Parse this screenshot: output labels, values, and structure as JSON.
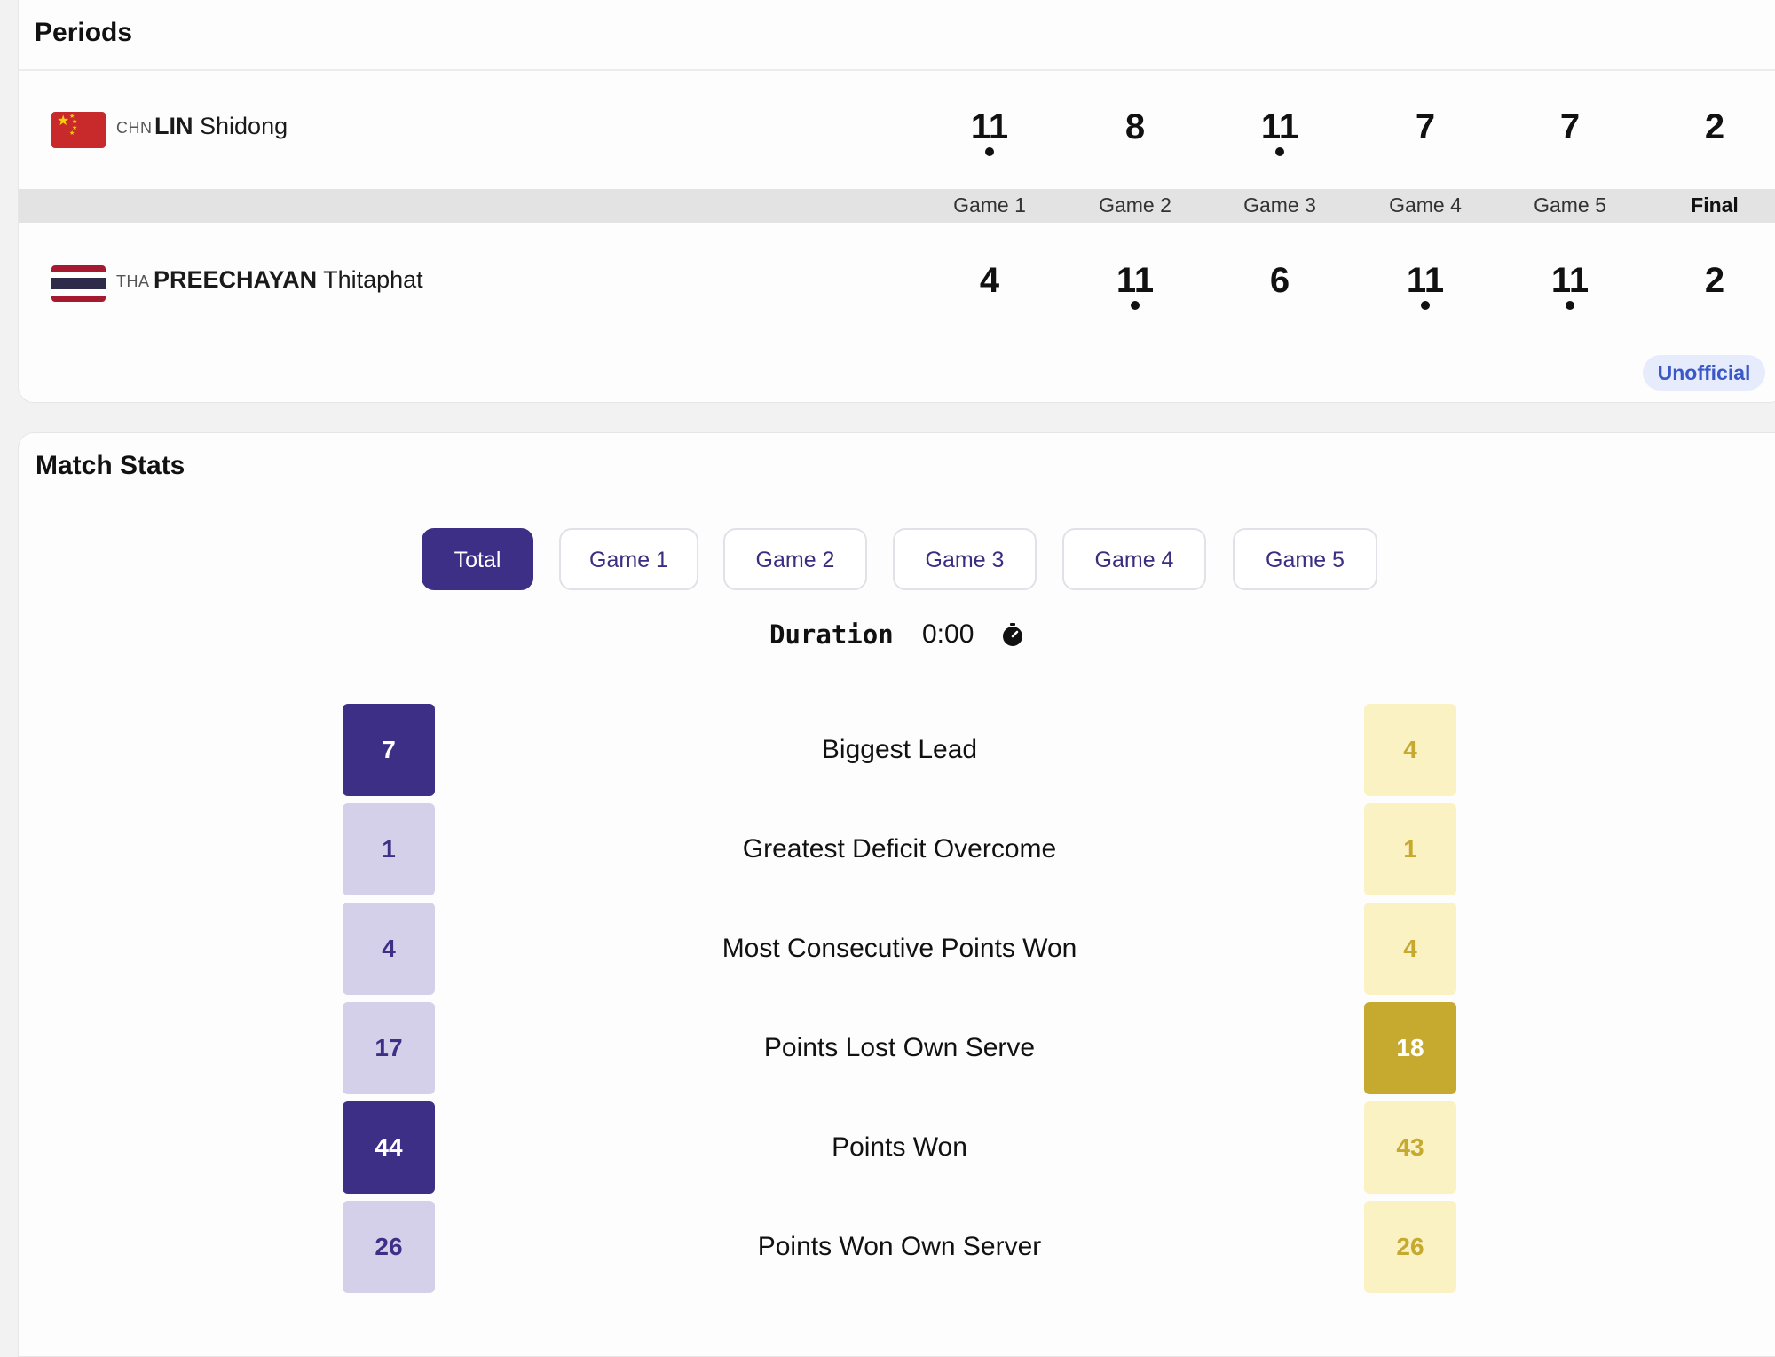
{
  "periods": {
    "title": "Periods",
    "players": [
      {
        "country": "CHN",
        "surname": "LIN",
        "given": "Shidong",
        "flag": "china-flag",
        "scores": [
          "11",
          "8",
          "11",
          "7",
          "7",
          "2"
        ]
      },
      {
        "country": "THA",
        "surname": "PREECHAYAN",
        "given": "Thitaphat",
        "flag": "thailand-flag",
        "scores": [
          "4",
          "11",
          "6",
          "11",
          "11",
          "2"
        ]
      }
    ],
    "games": [
      "Game 1",
      "Game 2",
      "Game 3",
      "Game 4",
      "Game 5",
      "Final"
    ],
    "status": "Unofficial"
  },
  "match_stats": {
    "title": "Match Stats",
    "tabs": [
      "Total",
      "Game 1",
      "Game 2",
      "Game 3",
      "Game 4",
      "Game 5"
    ],
    "active_tab": "Total",
    "duration_label": "Duration",
    "duration_value": "0:00",
    "stats": [
      {
        "label": "Biggest Lead",
        "left": "7",
        "right": "4"
      },
      {
        "label": "Greatest Deficit Overcome",
        "left": "1",
        "right": "1"
      },
      {
        "label": "Most Consecutive Points Won",
        "left": "4",
        "right": "4"
      },
      {
        "label": "Points Lost Own Serve",
        "left": "17",
        "right": "18"
      },
      {
        "label": "Points Won",
        "left": "44",
        "right": "43"
      },
      {
        "label": "Points Won Own Server",
        "left": "26",
        "right": "26"
      }
    ]
  },
  "colors": {
    "player1": "#3d2f86",
    "player1_light": "#d4d0ea",
    "player2": "#c6a92f",
    "player2_light": "#fbf2c4",
    "badge": "#3b58c9"
  }
}
